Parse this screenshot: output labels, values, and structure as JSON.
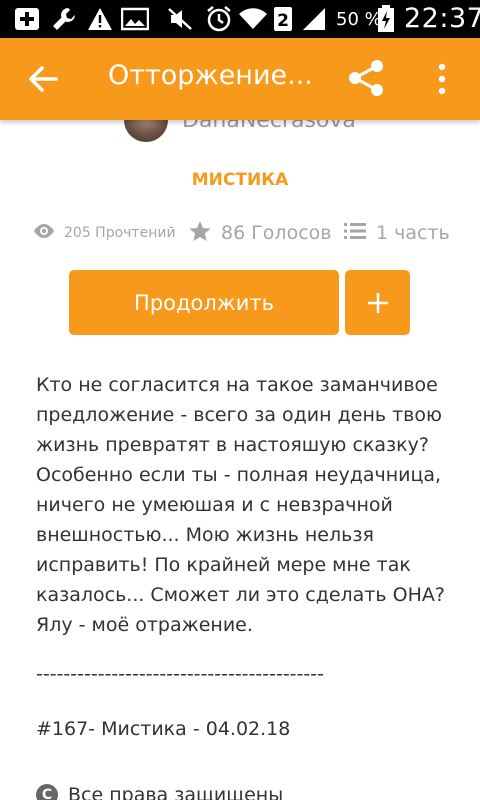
{
  "status_bar": {
    "battery_percent": "50 %",
    "time": "22:37",
    "signal_badge": "2",
    "icons": [
      "add-box-icon",
      "wrench-icon",
      "warning-icon",
      "image-icon",
      "mute-icon",
      "alarm-icon",
      "wifi-icon",
      "sim-2-icon",
      "signal-icon",
      "battery-charging-icon"
    ]
  },
  "app_bar": {
    "title": "Отторжение...",
    "color": "#f79a1c",
    "back_icon": "arrow-back-icon",
    "share_icon": "share-icon",
    "more_icon": "more-vert-icon"
  },
  "story": {
    "author": "DanaNecrasova",
    "category": "МИСТИКА",
    "stats": {
      "reads": "205 Прочтений",
      "votes": "86 Голосов",
      "parts": "1 часть"
    },
    "continue_label": "Продолжить",
    "add_label": "+",
    "description": "Кто не согласится на такое заманчивое предложение - всего за один день твою жизнь превратят в настояшую сказку? Особенно если ты - полная неудачница, ничего не умеюшая и с невзрачной внешностью... Мою жизнь нельзя исправить! По крайней мере мне так казалось... Сможет ли это сделать ОНА? Ялу - моё отражение.",
    "divider": "------------------------------------------",
    "tagline": "#167- Мистика - 04.02.18",
    "rights_icon": "C",
    "rights": "Все права защищены"
  }
}
